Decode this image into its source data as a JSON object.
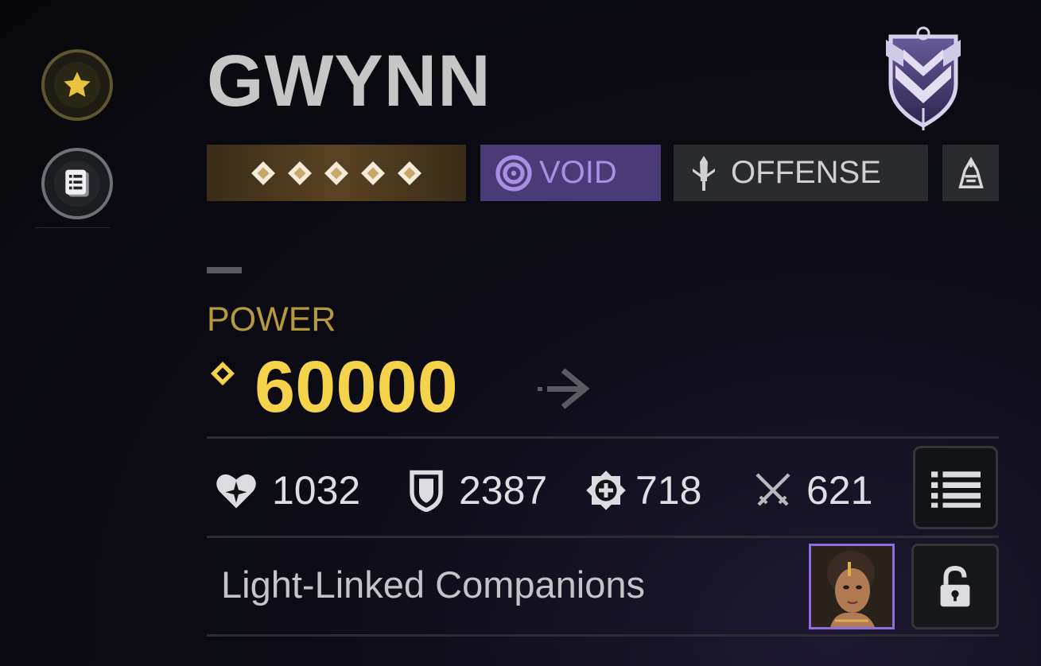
{
  "hero": {
    "name": "GWYNN",
    "rarity_stars": 5,
    "element": {
      "label": "VOID",
      "icon": "void-swirl-icon",
      "color": "#a88fe2"
    },
    "role": {
      "label": "OFFENSE",
      "icon": "sword-icon"
    },
    "faction_icon": "faction-emblem-icon",
    "rank_crest_icon": "rank-crest-icon"
  },
  "sidebar": {
    "items": [
      {
        "icon": "star-icon"
      },
      {
        "icon": "notes-icon"
      }
    ]
  },
  "power": {
    "label": "POWER",
    "value": "60000",
    "accent": "#f4d24a"
  },
  "stats": [
    {
      "icon": "health-heart-icon",
      "value": "1032"
    },
    {
      "icon": "defense-shield-icon",
      "value": "2387"
    },
    {
      "icon": "speed-icon",
      "value": "718"
    },
    {
      "icon": "attack-swords-icon",
      "value": "621"
    }
  ],
  "companions": {
    "label": "Light-Linked Companions",
    "lock_icon": "lock-icon"
  }
}
